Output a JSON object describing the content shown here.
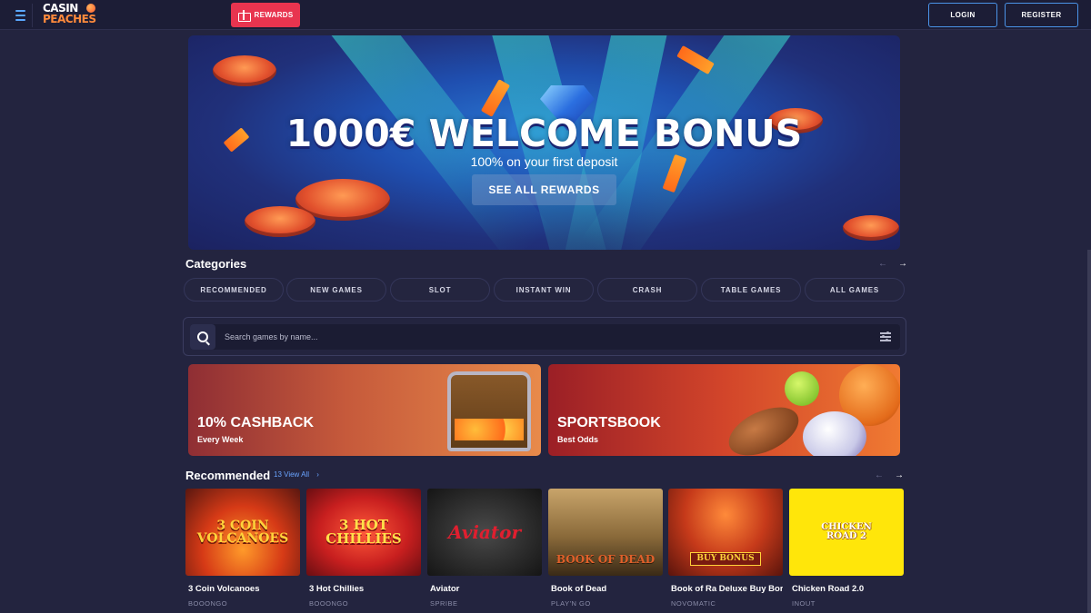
{
  "header": {
    "logo_line1": "CASIN",
    "logo_line2": "PEACHES",
    "rewards_label": "REWARDS",
    "login_label": "LOGIN",
    "register_label": "REGISTER"
  },
  "hero": {
    "title": "1000€ WELCOME BONUS",
    "subtitle": "100% on your first deposit",
    "button_label": "SEE ALL REWARDS"
  },
  "categories": {
    "title": "Categories",
    "items": [
      "RECOMMENDED",
      "NEW GAMES",
      "SLOT",
      "INSTANT WIN",
      "CRASH",
      "TABLE GAMES",
      "ALL GAMES"
    ]
  },
  "search": {
    "placeholder": "Search games by name..."
  },
  "promos": [
    {
      "title": "10% CASHBACK",
      "subtitle": "Every Week"
    },
    {
      "title": "SPORTSBOOK",
      "subtitle": "Best Odds"
    }
  ],
  "recommended": {
    "title": "Recommended",
    "view_all": "13 View All",
    "games": [
      {
        "name": "3 Coin Volcanoes",
        "provider": "BOOONGO",
        "thumb_text": "3 COIN VOLCANOES"
      },
      {
        "name": "3 Hot Chillies",
        "provider": "BOOONGO",
        "thumb_text": "3 HOT CHILLIES"
      },
      {
        "name": "Aviator",
        "provider": "SPRIBE",
        "thumb_text": "Aviator"
      },
      {
        "name": "Book of Dead",
        "provider": "PLAY'N GO",
        "thumb_text": "BOOK OF DEAD"
      },
      {
        "name": "Book of Ra Deluxe Buy Bor",
        "provider": "NOVOMATIC",
        "thumb_text": "BUY BONUS"
      },
      {
        "name": "Chicken Road 2.0",
        "provider": "INOUT",
        "thumb_text": "CHICKEN ROAD 2"
      }
    ]
  },
  "icons": {
    "menu": "hamburger-icon",
    "gift": "gift-icon",
    "search": "search-icon",
    "filter": "filter-icon",
    "arrow_left": "arrow-left-icon",
    "arrow_right": "arrow-right-icon",
    "chevron": "chevron-right-icon"
  },
  "colors": {
    "background": "#23243f",
    "accent_red": "#e8344f",
    "accent_blue": "#4a93e8",
    "link_blue": "#6aa4ff"
  }
}
